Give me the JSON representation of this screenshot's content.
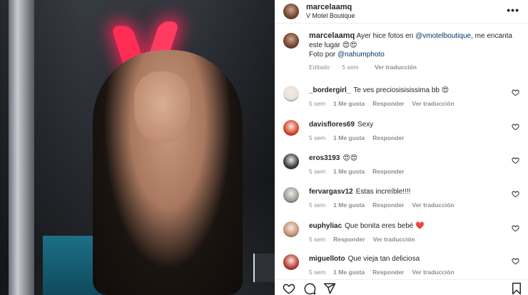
{
  "post": {
    "username": "marcelaamq",
    "location": "V Motel Boutique",
    "more_icon": "more-horizontal-icon"
  },
  "caption": {
    "username": "marcelaamq",
    "text_before": "Ayer hice fotos en ",
    "mention_venue": "@vmotelboutique",
    "text_after": ", me encanta este lugar 😍😍",
    "photo_credit_prefix": "Foto por ",
    "mention_photographer": "@nahumphoto",
    "edited_label": "Editado",
    "time": "5 sem",
    "translate_label": "Ver traducción"
  },
  "comments": [
    {
      "username": "_bordergirl_",
      "text": "Te ves preciosisisissima bb 😍",
      "time": "5 sem",
      "likes": "1 Me gusta",
      "reply": "Responder",
      "translate": "Ver traducción",
      "avatar_color": "#e8e2dc"
    },
    {
      "username": "davisflores69",
      "text": "Sexy",
      "time": "5 sem",
      "likes": "1 Me gusta",
      "reply": "Responder",
      "translate": "",
      "avatar_color": "#d6452b"
    },
    {
      "username": "eros3193",
      "text": "😍😍",
      "time": "5 sem",
      "likes": "1 Me gusta",
      "reply": "Responder",
      "translate": "",
      "avatar_color": "#3b3b3b"
    },
    {
      "username": "fervargasv12",
      "text": "Estas increíble!!!!",
      "time": "5 sem",
      "likes": "1 Me gusta",
      "reply": "Responder",
      "translate": "Ver traducción",
      "avatar_color": "#9a9a9a"
    },
    {
      "username": "euphyliac",
      "text": "Que bonita eres bebé ❤️",
      "time": "5 sem",
      "likes": "",
      "reply": "Responder",
      "translate": "Ver traducción",
      "avatar_color": "#c9907a"
    },
    {
      "username": "miguelloto",
      "text": "Que vieja tan deliciosa",
      "time": "5 sem",
      "likes": "1 Me gusta",
      "reply": "Responder",
      "translate": "Ver traducción",
      "avatar_color": "#b83a2e"
    }
  ],
  "actions": {
    "like_icon": "heart-icon",
    "comment_icon": "comment-icon",
    "share_icon": "share-icon",
    "save_icon": "bookmark-icon"
  }
}
